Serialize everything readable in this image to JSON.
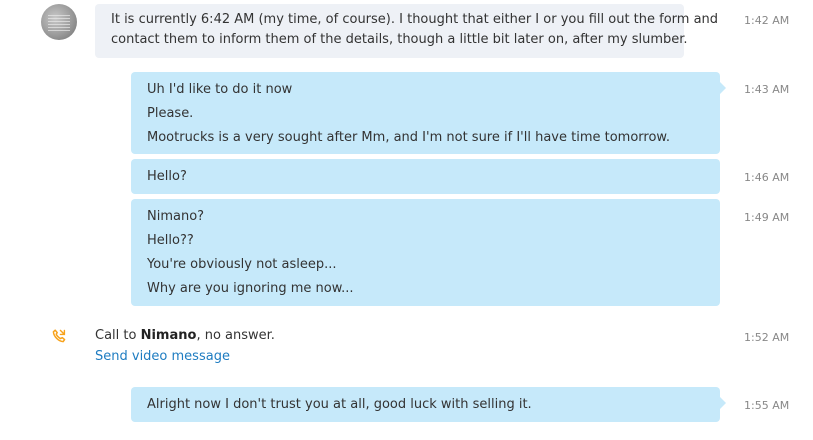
{
  "messages": {
    "incoming": {
      "text": "It is currently 6:42 AM (my time, of course). I thought that either I or you fill out the form and",
      "text2": "contact them to inform them of the details, though a little bit later on, after my slumber.",
      "time": "1:42 AM"
    },
    "group1": {
      "lines": [
        "Uh I'd like to do it now",
        "Please.",
        "Mootrucks is a very sought after Mm, and I'm not sure if I'll have time tomorrow."
      ],
      "time": "1:43 AM"
    },
    "group2": {
      "lines": [
        "Hello?"
      ],
      "time": "1:46 AM"
    },
    "group3": {
      "lines": [
        "Nimano?",
        "Hello??",
        "You're obviously not asleep...",
        "Why are you ignoring me now..."
      ],
      "time": "1:49 AM"
    },
    "call": {
      "prefix": "Call to ",
      "contact": "Nimano",
      "suffix": ", no answer.",
      "action": "Send video message",
      "time": "1:52 AM"
    },
    "group4": {
      "lines": [
        "Alright now I don't trust you at all, good luck with selling it."
      ],
      "time": "1:55 AM"
    }
  },
  "colors": {
    "incoming_bubble": "#eef1f6",
    "outgoing_bubble": "#c6e9fa",
    "link": "#1e7cc1",
    "call_icon": "#f7a21b"
  },
  "icons": {
    "call": "phone-missed-icon"
  }
}
